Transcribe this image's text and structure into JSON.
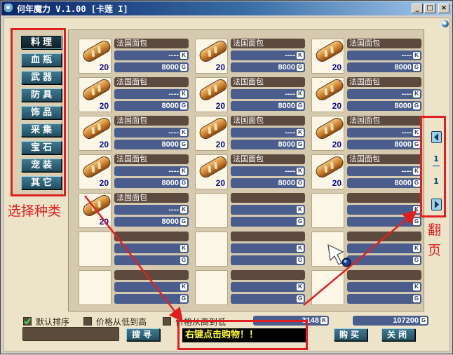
{
  "window": {
    "title": "何年魔力 V.1.00 [卡莲 I]",
    "min_label": "_",
    "max_label": "□",
    "close_label": "×"
  },
  "categories": [
    {
      "label": "料理",
      "active": true
    },
    {
      "label": "血瓶",
      "active": false
    },
    {
      "label": "武器",
      "active": false
    },
    {
      "label": "防具",
      "active": false
    },
    {
      "label": "饰品",
      "active": false
    },
    {
      "label": "采集",
      "active": false
    },
    {
      "label": "宝石",
      "active": false
    },
    {
      "label": "宠装",
      "active": false
    },
    {
      "label": "其它",
      "active": false
    }
  ],
  "items": [
    {
      "name": "法国面包",
      "stock": "---- ",
      "stock_unit": "K",
      "price": "8000",
      "price_unit": "G",
      "qty": "20",
      "icon": "bread-icon"
    },
    {
      "name": "法国面包",
      "stock": "---- ",
      "stock_unit": "K",
      "price": "8000",
      "price_unit": "G",
      "qty": "20",
      "icon": "bread-icon"
    },
    {
      "name": "法国面包",
      "stock": "---- ",
      "stock_unit": "K",
      "price": "8000",
      "price_unit": "G",
      "qty": "20",
      "icon": "bread-icon"
    },
    {
      "name": "法国面包",
      "stock": "---- ",
      "stock_unit": "K",
      "price": "8000",
      "price_unit": "G",
      "qty": "20",
      "icon": "bread-icon"
    },
    {
      "name": "法国面包",
      "stock": "---- ",
      "stock_unit": "K",
      "price": "8000",
      "price_unit": "G",
      "qty": "20",
      "icon": "bread-icon"
    },
    {
      "name": "法国面包",
      "stock": "---- ",
      "stock_unit": "K",
      "price": "8000",
      "price_unit": "G",
      "qty": "20",
      "icon": "bread-icon"
    },
    {
      "name": "法国面包",
      "stock": "---- ",
      "stock_unit": "K",
      "price": "8000",
      "price_unit": "G",
      "qty": "20",
      "icon": "bread-icon"
    },
    {
      "name": "法国面包",
      "stock": "---- ",
      "stock_unit": "K",
      "price": "8000",
      "price_unit": "G",
      "qty": "20",
      "icon": "bread-icon"
    },
    {
      "name": "法国面包",
      "stock": "---- ",
      "stock_unit": "K",
      "price": "8000",
      "price_unit": "G",
      "qty": "20",
      "icon": "bread-icon"
    },
    {
      "name": "法国面包",
      "stock": "---- ",
      "stock_unit": "K",
      "price": "8000",
      "price_unit": "G",
      "qty": "20",
      "icon": "bread-icon"
    },
    {
      "name": "法国面包",
      "stock": "---- ",
      "stock_unit": "K",
      "price": "8000",
      "price_unit": "G",
      "qty": "20",
      "icon": "bread-icon"
    },
    {
      "name": "法国面包",
      "stock": "---- ",
      "stock_unit": "K",
      "price": "8000",
      "price_unit": "G",
      "qty": "20",
      "icon": "bread-icon"
    },
    {
      "name": "法国面包",
      "stock": "---- ",
      "stock_unit": "K",
      "price": "8000",
      "price_unit": "G",
      "qty": "20",
      "icon": "bread-icon"
    },
    {
      "name": "",
      "stock": "",
      "stock_unit": "K",
      "price": "",
      "price_unit": "G",
      "qty": "",
      "icon": ""
    },
    {
      "name": "",
      "stock": "",
      "stock_unit": "K",
      "price": "",
      "price_unit": "G",
      "qty": "",
      "icon": ""
    },
    {
      "name": "",
      "stock": "",
      "stock_unit": "K",
      "price": "",
      "price_unit": "G",
      "qty": "",
      "icon": ""
    },
    {
      "name": "",
      "stock": "",
      "stock_unit": "K",
      "price": "",
      "price_unit": "G",
      "qty": "",
      "icon": ""
    },
    {
      "name": "",
      "stock": "",
      "stock_unit": "K",
      "price": "",
      "price_unit": "G",
      "qty": "",
      "icon": ""
    },
    {
      "name": "",
      "stock": "",
      "stock_unit": "K",
      "price": "",
      "price_unit": "G",
      "qty": "",
      "icon": ""
    },
    {
      "name": "",
      "stock": "",
      "stock_unit": "K",
      "price": "",
      "price_unit": "G",
      "qty": "",
      "icon": ""
    },
    {
      "name": "",
      "stock": "",
      "stock_unit": "K",
      "price": "",
      "price_unit": "G",
      "qty": "",
      "icon": ""
    }
  ],
  "pager": {
    "prev_icon": "arrow-left-icon",
    "next_icon": "arrow-right-icon",
    "current_page": "1",
    "total_pages": "1"
  },
  "sort_options": [
    {
      "label": "默认排序",
      "checked": true
    },
    {
      "label": "价格从低到高",
      "checked": false
    },
    {
      "label": "价格从高到低",
      "checked": false
    }
  ],
  "totals": {
    "stock_total": "3148",
    "stock_unit": "K",
    "gold_total": "107200",
    "gold_unit": "G"
  },
  "search": {
    "value": "",
    "button_label": "搜寻"
  },
  "message": "右键点击购物！！",
  "buy_label": "购买",
  "close_label": "关闭",
  "annotations": {
    "choose_category": "选择种类",
    "page_turn_top": "翻",
    "page_turn_bottom": "页"
  },
  "colors": {
    "annotation_red": "#e02020",
    "button_teal": "#2f6376",
    "panel_cream": "#ece3c8",
    "message_yellow": "#ffff40"
  }
}
